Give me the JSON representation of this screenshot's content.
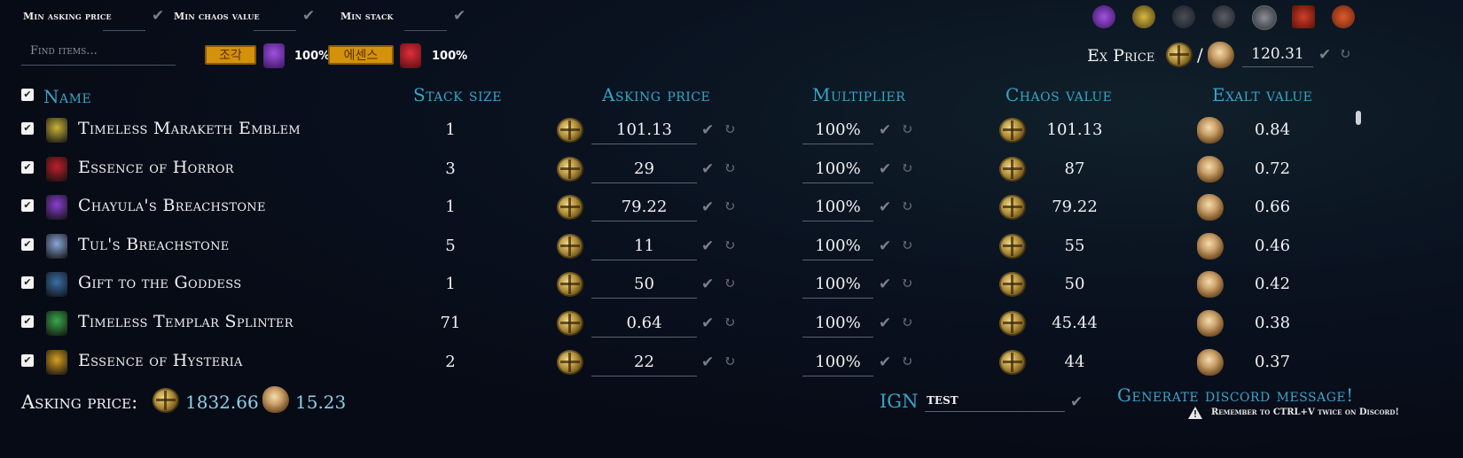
{
  "filters": {
    "min_asking_price_label": "Min asking price",
    "min_chaos_value_label": "Min chaos value",
    "min_stack_label": "Min stack",
    "find_items_placeholder": "Find items...",
    "tag_fragment": "조각",
    "tag_fragment_pct": "100%",
    "tag_essence": "에센스",
    "tag_essence_pct": "100%"
  },
  "exprice": {
    "label": "Ex Price",
    "separator": "/",
    "value": "120.31"
  },
  "headers": {
    "name": "Name",
    "stack_size": "Stack size",
    "asking_price": "Asking price",
    "multiplier": "Multiplier",
    "chaos_value": "Chaos value",
    "exalt_value": "Exalt value"
  },
  "rows": [
    {
      "name": "Timeless Maraketh Emblem",
      "stack": "1",
      "asking": "101.13",
      "multiplier": "100%",
      "chaos": "101.13",
      "exalt": "0.84",
      "icon": "emblem-icon",
      "color": "#c8b43a"
    },
    {
      "name": "Essence of Horror",
      "stack": "3",
      "asking": "29",
      "multiplier": "100%",
      "chaos": "87",
      "exalt": "0.72",
      "icon": "essence-icon",
      "color": "#c0202a"
    },
    {
      "name": "Chayula's Breachstone",
      "stack": "1",
      "asking": "79.22",
      "multiplier": "100%",
      "chaos": "79.22",
      "exalt": "0.66",
      "icon": "breachstone-icon",
      "color": "#8a3fd0"
    },
    {
      "name": "Tul's Breachstone",
      "stack": "5",
      "asking": "11",
      "multiplier": "100%",
      "chaos": "55",
      "exalt": "0.46",
      "icon": "breachstone-icon",
      "color": "#8aa6d8"
    },
    {
      "name": "Gift to the Goddess",
      "stack": "1",
      "asking": "50",
      "multiplier": "100%",
      "chaos": "50",
      "exalt": "0.42",
      "icon": "gift-icon",
      "color": "#3a6fa8"
    },
    {
      "name": "Timeless Templar Splinter",
      "stack": "71",
      "asking": "0.64",
      "multiplier": "100%",
      "chaos": "45.44",
      "exalt": "0.38",
      "icon": "splinter-icon",
      "color": "#3aa84a"
    },
    {
      "name": "Essence of Hysteria",
      "stack": "2",
      "asking": "22",
      "multiplier": "100%",
      "chaos": "44",
      "exalt": "0.37",
      "icon": "essence-icon",
      "color": "#d8a020"
    }
  ],
  "totals": {
    "label": "Asking price:",
    "chaos": "1832.66",
    "exalt": "15.23"
  },
  "ign": {
    "label": "IGN",
    "value": "TEST"
  },
  "discord": {
    "button": "Generate discord message!",
    "reminder": "Remember to CTRL+V twice on Discord!"
  },
  "top_icons": [
    "breachstone-icon",
    "emblem-icon",
    "shaper-icon",
    "elder-icon",
    "atlas-icon",
    "essence-icon",
    "chaos-emblem-icon"
  ],
  "colors": {
    "accent": "#3ba3c8",
    "tag": "#d4910c",
    "total_value": "#8fd0e8"
  }
}
